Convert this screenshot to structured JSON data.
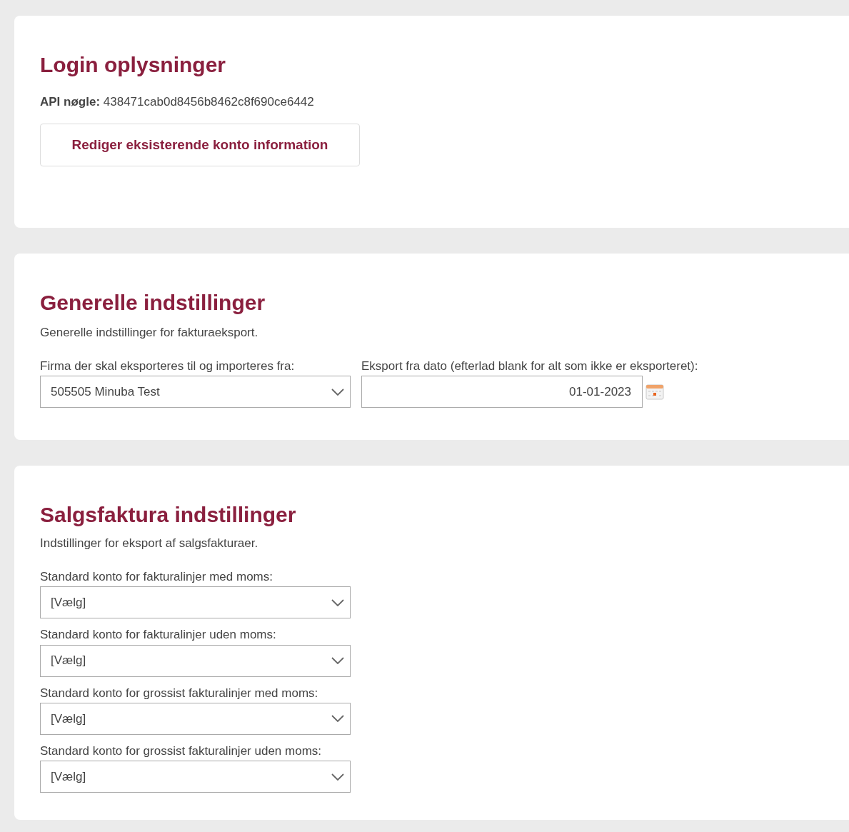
{
  "login": {
    "title": "Login oplysninger",
    "api_label": "API nøgle:",
    "api_key": "438471cab0d8456b8462c8f690ce6442",
    "edit_button": "Rediger eksisterende konto information"
  },
  "general": {
    "title": "Generelle indstillinger",
    "description": "Generelle indstillinger for fakturaeksport.",
    "fields": [
      {
        "kind": "select",
        "label": "Firma der skal eksporteres til og importeres fra:",
        "value": "505505 Minuba Test"
      },
      {
        "kind": "date",
        "label": "Eksport fra dato (efterlad blank for alt som ikke er eksporteret):",
        "value": "01-01-2023"
      }
    ]
  },
  "sales": {
    "title": "Salgsfaktura indstillinger",
    "description": "Indstillinger for eksport af salgsfakturaer.",
    "fields": [
      {
        "kind": "select",
        "label": "Standard konto for fakturalinjer med moms:",
        "value": "[Vælg]"
      },
      {
        "kind": "select",
        "label": "Standard konto for fakturalinjer uden moms:",
        "value": "[Vælg]"
      },
      {
        "kind": "select",
        "label": "Standard konto for grossist fakturalinjer med moms:",
        "value": "[Vælg]"
      },
      {
        "kind": "select",
        "label": "Standard konto for grossist fakturalinjer uden moms:",
        "value": "[Vælg]"
      }
    ]
  }
}
